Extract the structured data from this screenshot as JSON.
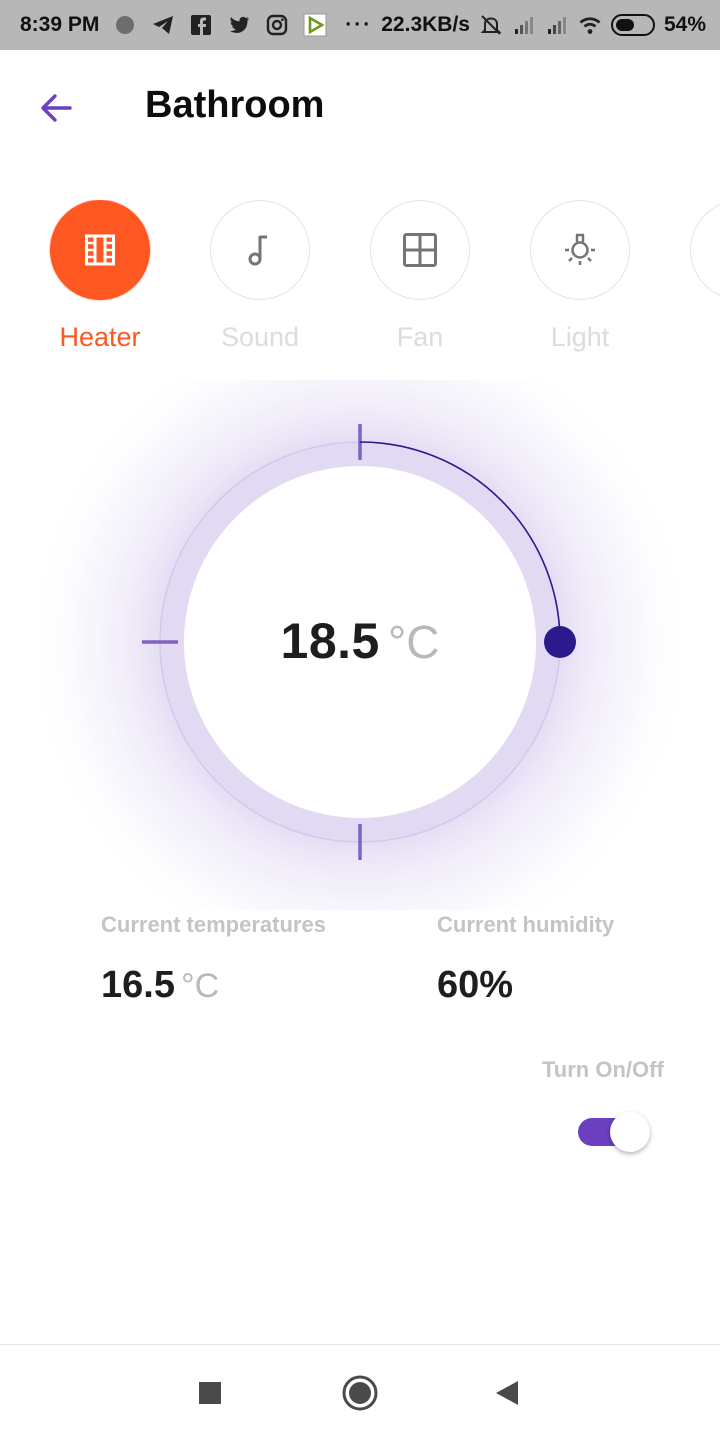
{
  "status_bar": {
    "time": "8:39 PM",
    "network_speed": "22.3KB/s",
    "battery_percent": "54%",
    "battery_level": 0.54,
    "icons": [
      "notification-dot-icon",
      "telegram-icon",
      "facebook-icon",
      "twitter-icon",
      "instagram-icon",
      "app-icon",
      "more-dots-icon",
      "mute-icon",
      "signal-icon",
      "signal-icon",
      "wifi-icon",
      "battery-icon"
    ]
  },
  "header": {
    "title": "Bathroom",
    "back_icon": "arrow-left-icon"
  },
  "devices": [
    {
      "label": "Heater",
      "icon": "heater-icon",
      "active": true
    },
    {
      "label": "Sound",
      "icon": "music-note-icon",
      "active": false
    },
    {
      "label": "Fan",
      "icon": "grid-icon",
      "active": false
    },
    {
      "label": "Light",
      "icon": "bulb-icon",
      "active": false
    }
  ],
  "thermostat": {
    "set_value": "18.5",
    "unit": "°C"
  },
  "readings": {
    "temperature_label": "Current temperatures",
    "temperature_value": "16.5",
    "temperature_unit": "°C",
    "humidity_label": "Current humidity",
    "humidity_value": "60%"
  },
  "power": {
    "label": "Turn On/Off",
    "on": true
  },
  "colors": {
    "accent": "#ff5722",
    "primary": "#6b3fc0",
    "dial_indicator": "#2b1a8c",
    "halo": "#e3dcf1"
  },
  "nav_bar": {
    "icons": [
      "recent-apps-icon",
      "home-icon",
      "back-icon"
    ]
  }
}
